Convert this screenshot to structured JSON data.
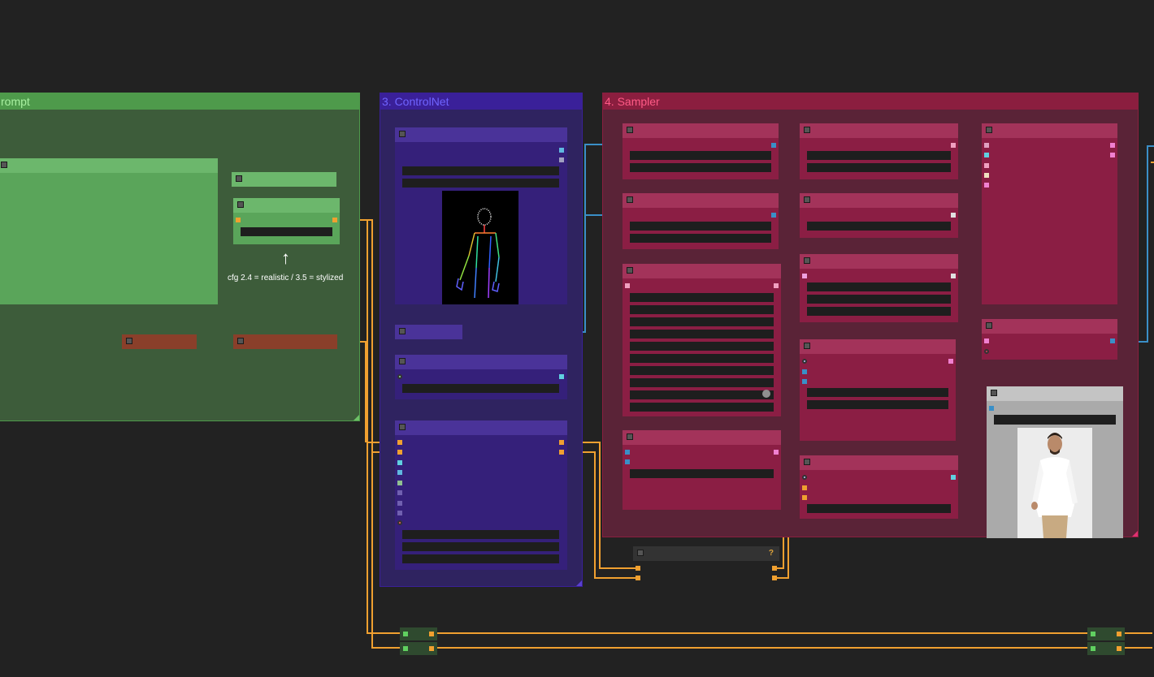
{
  "groups": {
    "prompt": {
      "title": "rompt",
      "color": "#3d5c3a",
      "header_color": "#4e9a4b",
      "title_color": "#a8f0a0"
    },
    "controlnet": {
      "title": "3. ControlNet",
      "color": "#2f2360",
      "header_color": "#3a2099",
      "title_color": "#6f64ff"
    },
    "sampler": {
      "title": "4. Sampler",
      "color": "#5a2337",
      "header_color": "#8b1e3f",
      "title_color": "#ff5a86"
    }
  },
  "annotations": {
    "cfg_arrow": "↑",
    "cfg_note": "cfg 2.4 = realistic / 3.5 = stylized",
    "help_badge": "?"
  },
  "previews": {
    "pose_skeleton": "pose-skeleton-preview",
    "output_model": "generated-model-preview"
  },
  "colors": {
    "wire_orange": "#f0a030",
    "wire_blue": "#3a8fc7",
    "wire_pink": "#f080d0",
    "wire_cyan": "#60d0e0",
    "wire_white": "#e0e0e0",
    "wire_green": "#8fcf40",
    "canvas_bg": "#222222"
  }
}
